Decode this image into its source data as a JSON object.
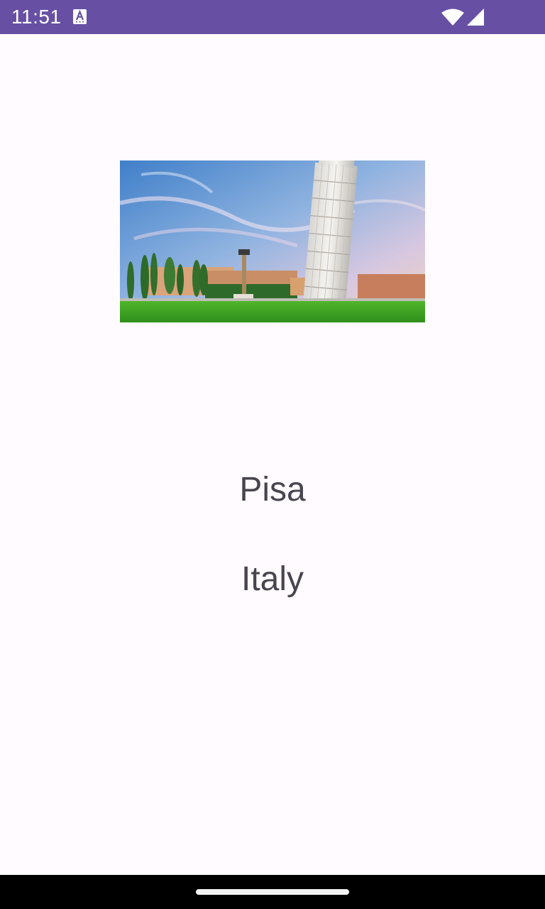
{
  "status_bar": {
    "time": "11:51",
    "background_color": "#6750a4",
    "icons": [
      "text-a-notification-icon",
      "wifi-icon",
      "cellular-signal-icon"
    ]
  },
  "main": {
    "image": {
      "subject": "Leaning Tower of Pisa",
      "alt": "Pisa"
    },
    "city": "Pisa",
    "country": "Italy",
    "text_color": "#49454f",
    "background_color": "#fffbfe"
  },
  "navigation_bar": {
    "icons": [
      "home-gesture-handle"
    ]
  }
}
